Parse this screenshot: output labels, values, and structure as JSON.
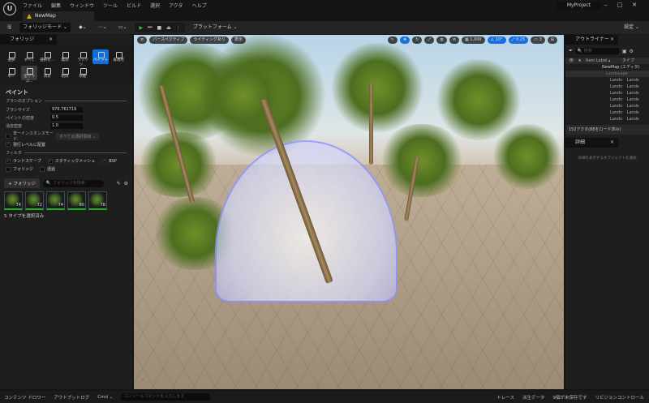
{
  "window": {
    "project": "MyProject",
    "menu": [
      "ファイル",
      "編集",
      "ウィンドウ",
      "ツール",
      "ビルド",
      "選択",
      "アクタ",
      "ヘルプ"
    ],
    "tab": "NewMap"
  },
  "toolbar": {
    "mode": "フォリッジモード ⌄",
    "platform": "プラットフォーム ⌄",
    "settings": "設定 ⌄"
  },
  "foliage": {
    "tab": "フォリッジ",
    "modes": [
      "選択",
      "すべて",
      "選択を...",
      "無効",
      "ラッソツ...",
      "ペイント",
      "再適用",
      "単一",
      "塗りつぶ...",
      "消去",
      "削除",
      "移動"
    ],
    "section": "ペイント",
    "brush_options": "ブラシのオプション",
    "brush_size_label": "ブラシサイズ",
    "brush_size": "976.761719",
    "paint_density_label": "ペイントの密度",
    "paint_density": "0.5",
    "erase_density_label": "消去密度",
    "erase_density": "1.0",
    "single_instance": "単一インスタンスモード:",
    "single_instance_value": "すべての選択項目 ⌄",
    "place_in_level": "現行レベルに配置",
    "filter": "フィルタ",
    "filters": [
      {
        "label": "ランドスケープ",
        "checked": true
      },
      {
        "label": "スタティックメッシュ",
        "checked": true
      },
      {
        "label": "BSP",
        "checked": true
      },
      {
        "label": "フォリッジ",
        "checked": false
      },
      {
        "label": "透過",
        "checked": false
      }
    ],
    "add_button": "+ フォリッジ",
    "search_placeholder": "フォリッジを検索",
    "thumbs": [
      "74",
      "72",
      "74",
      "80",
      "78"
    ],
    "selected": "5 タイプを選択済み"
  },
  "viewport": {
    "perspective": "パースペクティブ",
    "lighting": "ライティングあり",
    "show": "表示",
    "grid": "1,000",
    "angle": "10°",
    "scale": "0.25",
    "camera": "3"
  },
  "outliner": {
    "tab": "アウトライナー",
    "search": "検索",
    "col_label": "Item Label ▴",
    "col_type": "タイプ",
    "root": "NewMap (エディタ)",
    "landscape": "Landscape",
    "rows": [
      "Lands",
      "Lands",
      "Lands",
      "Lands",
      "Lands",
      "Lands",
      "Lands"
    ],
    "row_type": "Lands",
    "count": "152アクタ(88をロード済み)"
  },
  "details": {
    "tab": "詳細",
    "empty": "詳細を表示するオブジェクトを選択"
  },
  "statusbar": {
    "content_drawer": "コンテンツ ドロワー",
    "output_log": "アウトプットログ",
    "cmd": "Cmd ⌄",
    "console_placeholder": "コンソールコマンドを入力します",
    "trace": "トレース",
    "derived": "派生データ",
    "unsaved": "9個が未保存です",
    "revision": "リビジョンコントロール"
  }
}
